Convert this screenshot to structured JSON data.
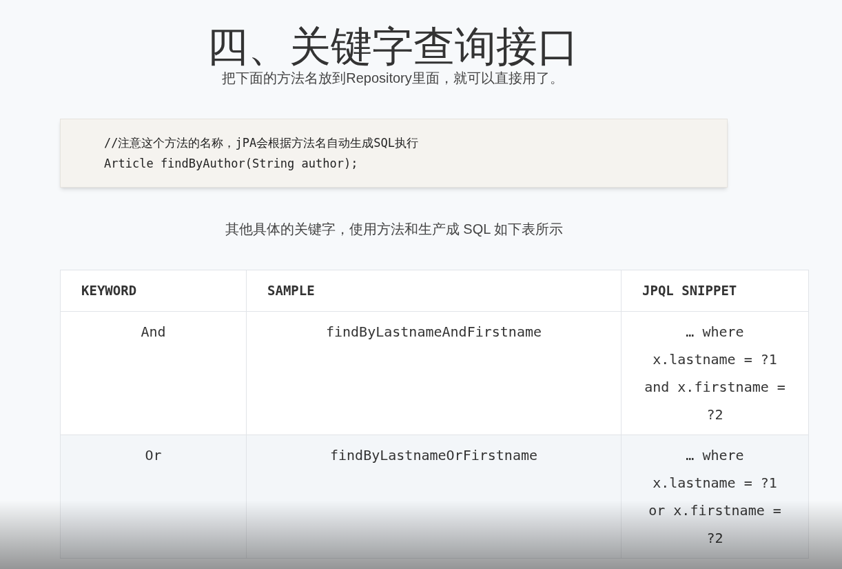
{
  "title": "四、关键字查询接口",
  "subtitle": "把下面的方法名放到Repository里面，就可以直接用了。",
  "code_block": {
    "lines": [
      "//注意这个方法的名称，jPA会根据方法名自动生成SQL执行",
      "Article findByAuthor(String author);"
    ]
  },
  "intro": "其他具体的关键字，使用方法和生产成 SQL 如下表所示",
  "table": {
    "columns": [
      "KEYWORD",
      "SAMPLE",
      "JPQL SNIPPET"
    ],
    "rows": [
      {
        "cells": [
          "And",
          "findByLastnameAndFirstname",
          "… where x.lastname = ?1 and x.firstname = ?2"
        ]
      },
      {
        "cells": [
          "Or",
          "findByLastnameOrFirstname",
          "… where x.lastname = ?1 or x.firstname = ?2"
        ]
      }
    ]
  }
}
